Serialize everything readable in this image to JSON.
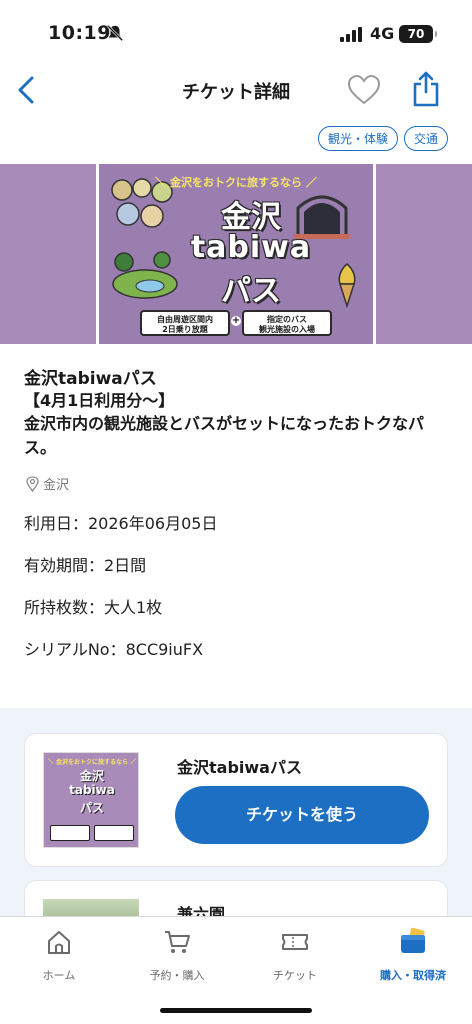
{
  "status": {
    "time": "10:19",
    "network": "4G",
    "battery": "70"
  },
  "nav": {
    "title": "チケット詳細"
  },
  "tags": [
    "観光・体験",
    "交通"
  ],
  "banner": {
    "tagline": "＼ 金沢をおトクに旅するなら ／",
    "line1": "金沢",
    "line2": "tabiwa",
    "line3": "パス",
    "pill1": "自由周遊区間内\n2日乗り放題",
    "pill2": "指定のバス\n観光施設の入場"
  },
  "ticket": {
    "name": "金沢tabiwaパス",
    "subtitle": "【4月1日利用分〜】",
    "description": "金沢市内の観光施設とバスがセットになったおトクなパス。",
    "location": "金沢",
    "use_date": "利用日：2026年06月05日",
    "validity": "有効期間：2日間",
    "count": "所持枚数：大人1枚",
    "serial": "シリアルNo：8CC9iuFX"
  },
  "cards": [
    {
      "title": "金沢tabiwaパス",
      "button": "チケットを使う"
    },
    {
      "title": "兼六園"
    }
  ],
  "tabbar": {
    "items": [
      {
        "label": "ホーム",
        "icon": "home-icon"
      },
      {
        "label": "予約・購入",
        "icon": "cart-icon"
      },
      {
        "label": "チケット",
        "icon": "ticket-icon"
      },
      {
        "label": "購入・取得済",
        "icon": "wallet-icon"
      }
    ]
  },
  "colors": {
    "accent": "#1d6fc4",
    "banner": "#a98bba"
  }
}
